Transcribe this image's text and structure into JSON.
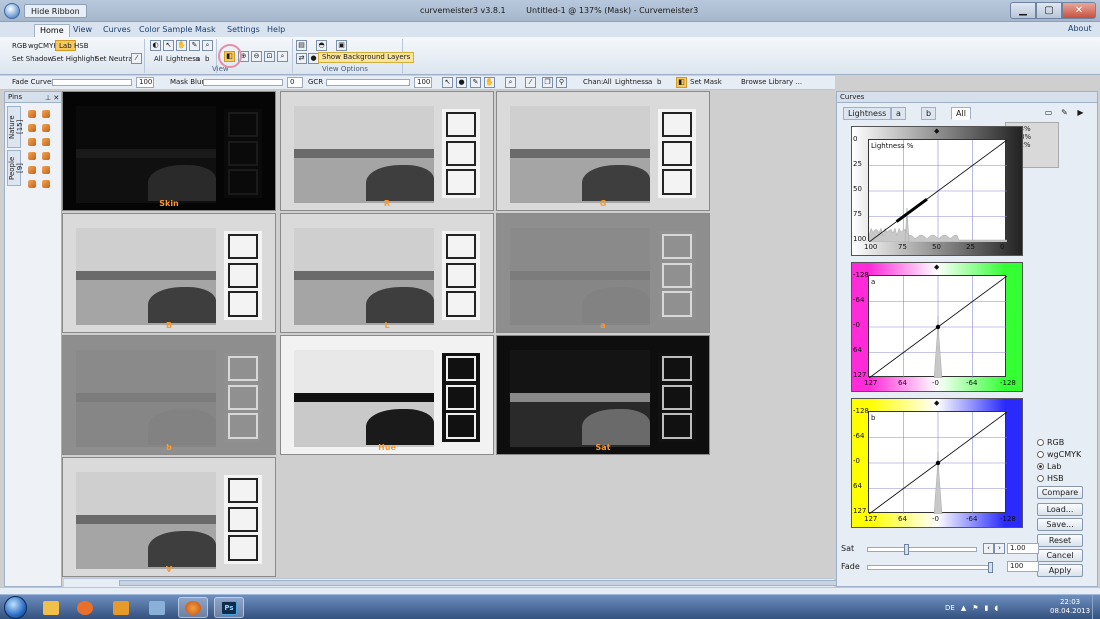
{
  "titlebar": {
    "hide_ribbon": "Hide Ribbon",
    "app_name": "curvemeister3 v3.8.1",
    "document": "Untitled-1 @ 137% (Mask) - Curvemeister3"
  },
  "tabs": [
    "Home",
    "View",
    "Curves",
    "Color Sample",
    "Mask",
    "Settings",
    "Help"
  ],
  "about": "About",
  "ribbon": {
    "modes": [
      "RGB",
      "wgCMYK",
      "Lab",
      "HSB"
    ],
    "set_buttons": [
      "Set Shadow",
      "Set Highlight",
      "Set Neutral"
    ],
    "channels": [
      "All",
      "Lightness",
      "a",
      "b"
    ],
    "tooltip": "Show Background Layers",
    "view_label": "View",
    "view_options_label": "View Options"
  },
  "toolbar2": {
    "fade_curves": "Fade Curves",
    "fade_value": "100",
    "mask_blur": "Mask Blur",
    "mask_value": "0",
    "gcr": "GCR",
    "gcr_value": "100",
    "chan_label": "Chan:",
    "chan_items": [
      "All",
      "Lightness",
      "a",
      "b"
    ],
    "set_mask": "Set Mask",
    "browse_library": "Browse Library ..."
  },
  "pins": {
    "title": "Pins",
    "tabs": [
      "Nature [15]",
      "People [9]"
    ]
  },
  "thumbnails": [
    {
      "label": "Skin",
      "style": "dark"
    },
    {
      "label": "R",
      "style": "gray"
    },
    {
      "label": "G",
      "style": "gray"
    },
    {
      "label": "B",
      "style": "gray"
    },
    {
      "label": "L",
      "style": "gray"
    },
    {
      "label": "a",
      "style": "flat"
    },
    {
      "label": "b",
      "style": "flat"
    },
    {
      "label": "Hue",
      "style": "contrast"
    },
    {
      "label": "Sat",
      "style": "dark2"
    },
    {
      "label": "V",
      "style": "gray"
    }
  ],
  "curves": {
    "title": "Curves",
    "tabs": [
      "Lightness",
      "a",
      "b",
      "All"
    ],
    "info": [
      "R  33%",
      "G  33%",
      "B  32%"
    ],
    "plots": [
      {
        "name": "Lightness",
        "label": "Lightness %",
        "yticks": [
          "0",
          "25",
          "50",
          "75",
          "100"
        ],
        "xticks": [
          "100",
          "75",
          "50",
          "25",
          "0"
        ],
        "bg": "gray"
      },
      {
        "name": "a",
        "label": "a",
        "yticks": [
          "-128",
          "-64",
          "-0",
          "64",
          "127"
        ],
        "xticks": [
          "127",
          "64",
          "-0",
          "-64",
          "-128"
        ],
        "bg": "magenta-green"
      },
      {
        "name": "b",
        "label": "b",
        "yticks": [
          "-128",
          "-64",
          "-0",
          "64",
          "127"
        ],
        "xticks": [
          "127",
          "64",
          "-0",
          "-64",
          "-128"
        ],
        "bg": "yellow-blue"
      }
    ],
    "modes": [
      {
        "label": "RGB",
        "selected": false
      },
      {
        "label": "wgCMYK",
        "selected": false
      },
      {
        "label": "Lab",
        "selected": true
      },
      {
        "label": "HSB",
        "selected": false
      }
    ],
    "buttons": [
      "Compare",
      "Load...",
      "Save...",
      "Reset",
      "Cancel",
      "Apply"
    ],
    "sat_label": "Sat",
    "sat_value": "1.00",
    "fade_label": "Fade",
    "fade_value": "100"
  },
  "taskbar": {
    "lang": "DE",
    "time": "22:03",
    "date": "08.04.2013",
    "ps_label": "Ps"
  },
  "colors": {
    "accent": "#f6c85f",
    "thumb_label": "#ff9a2a",
    "tooltip_bg": "#fbe59c"
  }
}
